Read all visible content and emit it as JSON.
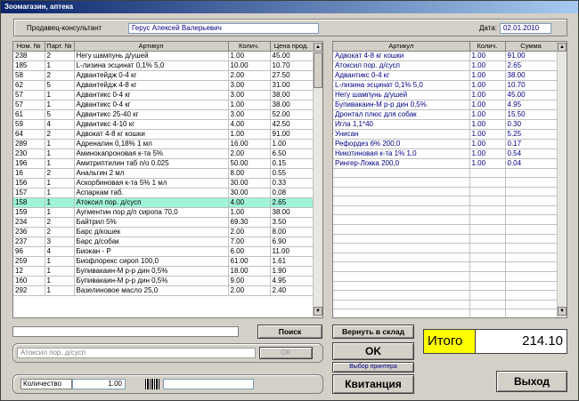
{
  "window": {
    "title": "Зоомагазин, аптека"
  },
  "seller": {
    "label": "Продавец-консультант",
    "name": "Герус Алексей Валерьевич"
  },
  "date": {
    "label": "Дата:",
    "value": "02.01.2010"
  },
  "left_grid": {
    "headers": [
      "Ном. №",
      "Парт. №",
      "Артикул",
      "Колич.",
      "Цена прод."
    ],
    "rows": [
      [
        "238",
        "2",
        "Негу шампунь д/ушей",
        "1.00",
        "45.00"
      ],
      [
        "185",
        "1",
        "L-лизина эсцинат 0,1% 5,0",
        "10.00",
        "10.70"
      ],
      [
        "58",
        "2",
        "Адвантейдж 0-4 кг",
        "2.00",
        "27.50"
      ],
      [
        "62",
        "5",
        "Адвантейдж 4-8 кг",
        "3.00",
        "31.00"
      ],
      [
        "57",
        "1",
        "Адвантикс 0-4 кг",
        "3.00",
        "38.00"
      ],
      [
        "57",
        "1",
        "Адвантикс 0-4 кг",
        "1.00",
        "38.00"
      ],
      [
        "61",
        "5",
        "Адвантикс 25-40 кг",
        "3.00",
        "52.00"
      ],
      [
        "59",
        "4",
        "Адвантикс 4-10 кг",
        "4.00",
        "42.50"
      ],
      [
        "64",
        "2",
        "Адвокат 4-8 кг кошки",
        "1.00",
        "91.00"
      ],
      [
        "289",
        "1",
        "Адреналин 0,18% 1 мл",
        "16.00",
        "1.00"
      ],
      [
        "230",
        "1",
        "Аминокапроновая к-та 5%",
        "2.00",
        "6.50"
      ],
      [
        "196",
        "1",
        "Амитриптилин таб п/о 0.025",
        "50.00",
        "0.15"
      ],
      [
        "16",
        "2",
        "Анальгин 2 мл",
        "8.00",
        "0.55"
      ],
      [
        "156",
        "1",
        "Аскорбиновая к-та 5% 1 мл",
        "30.00",
        "0.33"
      ],
      [
        "157",
        "1",
        "Аспаркам таб.",
        "30.00",
        "0.08"
      ],
      [
        "158",
        "1",
        "Атоксил пор. д/сусп",
        "4.00",
        "2.65"
      ],
      [
        "159",
        "1",
        "Аугментин пор д/п сиропа 70,0",
        "1.00",
        "38.00"
      ],
      [
        "234",
        "2",
        "Байтрил 5%",
        "69.30",
        "3.50"
      ],
      [
        "236",
        "2",
        "Барс д/кошек",
        "2.00",
        "8.00"
      ],
      [
        "237",
        "3",
        "Барс д/собак",
        "7.00",
        "6.90"
      ],
      [
        "96",
        "4",
        "Биокан - Р",
        "6.00",
        "11.00"
      ],
      [
        "259",
        "1",
        "Биофлорекс сироп 100,0",
        "61.00",
        "1.61"
      ],
      [
        "12",
        "1",
        "Бупивакаин-М р-р дин 0,5%",
        "18.00",
        "1.90"
      ],
      [
        "160",
        "1",
        "Бупивакаин-М р-р дин 0,5%",
        "9.00",
        "4.95"
      ],
      [
        "292",
        "1",
        "Вазелиновое масло 25,0",
        "2.00",
        "2.40"
      ]
    ],
    "selected_index": 15
  },
  "right_grid": {
    "headers": [
      "Артикул",
      "Колич.",
      "Сумма"
    ],
    "rows": [
      [
        "Адвокат 4-8 кг кошки",
        "1.00",
        "91.00"
      ],
      [
        "Атоксил пор. д/сусп",
        "1.00",
        "2.65"
      ],
      [
        "Адвантикс 0-4 кг",
        "1.00",
        "38.00"
      ],
      [
        "L-лизина эсцинат 0,1% 5,0",
        "1.00",
        "10.70"
      ],
      [
        "Негу шампунь д/ушей",
        "1.00",
        "45.00"
      ],
      [
        "Бупивакаин-М р-р дин 0,5%",
        "1.00",
        "4.95"
      ],
      [
        "Дронтал плюс для собак",
        "1.00",
        "15.50"
      ],
      [
        "Игла 1,1*40",
        "1.00",
        "0.30"
      ],
      [
        "Унисан",
        "1.00",
        "5.25"
      ],
      [
        "Рефордез 6% 200,0",
        "1.00",
        "0.17"
      ],
      [
        "Никотиновая к-та 1% 1,0",
        "1.00",
        "0.54"
      ],
      [
        "Рингер-Локка 200,0",
        "1.00",
        "0.04"
      ]
    ]
  },
  "search": {
    "value": "",
    "button": "Поиск"
  },
  "selected_item": {
    "value": "Атоксил пор. д/сусп",
    "ok_small": "OK"
  },
  "quantity": {
    "label": "Количество",
    "value": "1.00"
  },
  "buttons": {
    "return": "Вернуть в склад",
    "ok": "OK",
    "printer": "Выбор принтера",
    "receipt": "Квитанция",
    "exit": "Выход"
  },
  "total": {
    "label": "Итого",
    "value": "214.10"
  },
  "colors": {
    "selected_row": "#9ff5d6",
    "itogo_bg": "#ffff00",
    "title_start": "#0a246a"
  }
}
